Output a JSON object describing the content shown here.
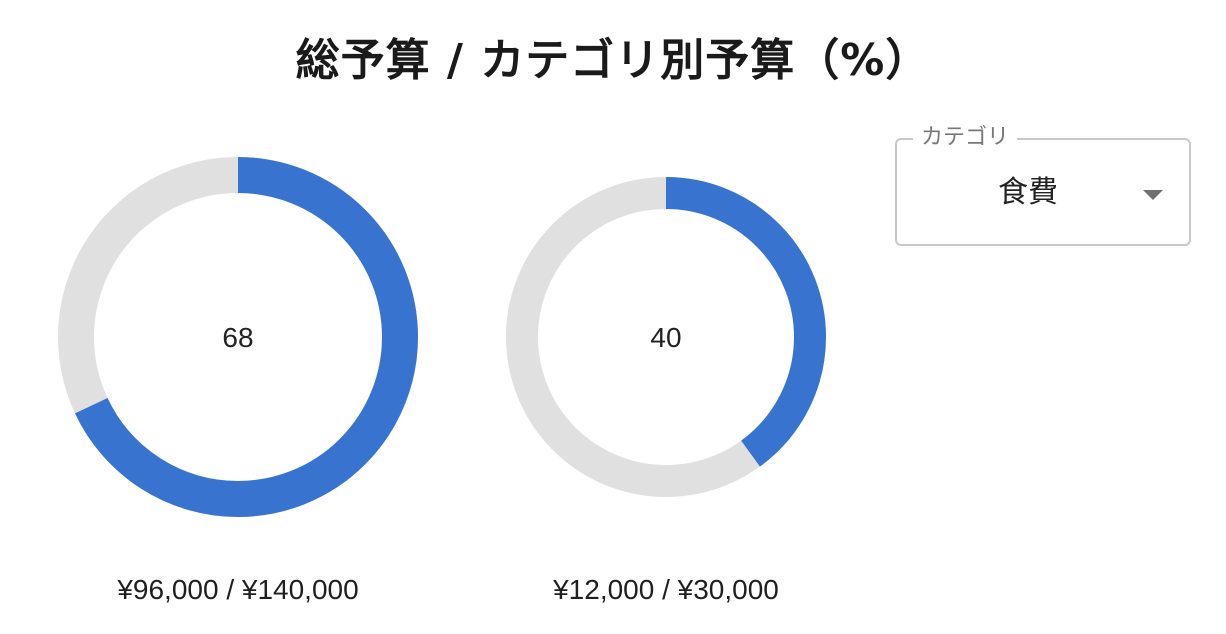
{
  "title": "総予算 / カテゴリ別予算（%）",
  "colors": {
    "filled": "#3874cf",
    "track": "#e0e0e0"
  },
  "chart_data": [
    {
      "type": "pie",
      "variant": "donut",
      "value": 68,
      "max": 100,
      "center_label": "68",
      "caption": "¥96,000 / ¥140,000"
    },
    {
      "type": "pie",
      "variant": "donut",
      "value": 40,
      "max": 100,
      "center_label": "40",
      "caption": "¥12,000 / ¥30,000"
    }
  ],
  "category_select": {
    "label": "カテゴリ",
    "selected": "食費",
    "icon": "caret-down-icon"
  }
}
